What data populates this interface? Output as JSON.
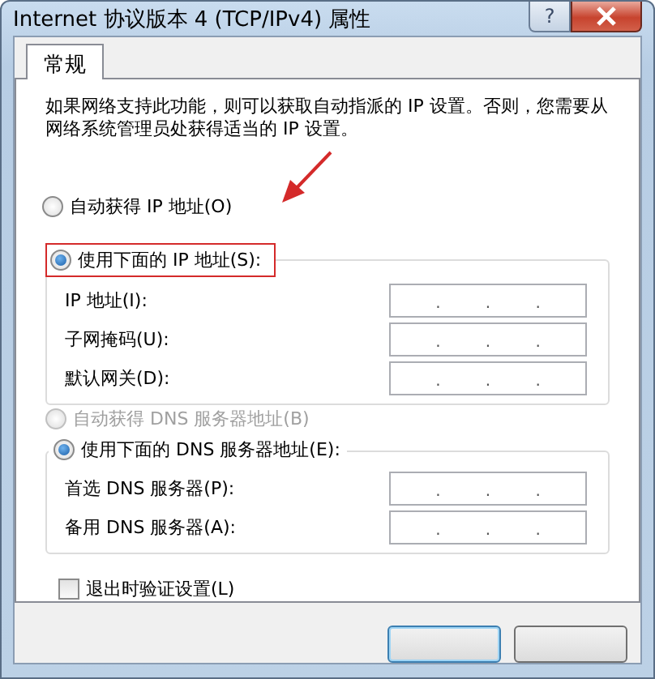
{
  "window": {
    "title": "Internet 协议版本 4 (TCP/IPv4) 属性",
    "help": "?"
  },
  "tabs": [
    {
      "label": "常规",
      "selected": true
    }
  ],
  "description": "如果网络支持此功能，则可以获取自动指派的 IP 设置。否则，您需要从网络系统管理员处获得适当的 IP 设置。",
  "ip_mode": [
    {
      "label": "自动获得 IP 地址(O)",
      "selected": false,
      "disabled": false,
      "highlighted": false
    },
    {
      "label": "使用下面的 IP 地址(S):",
      "selected": true,
      "disabled": false,
      "highlighted": true
    }
  ],
  "ip_fields": [
    {
      "label": "IP 地址(I):",
      "separators": [
        ".",
        ".",
        "."
      ]
    },
    {
      "label": "子网掩码(U):",
      "separators": [
        ".",
        ".",
        "."
      ]
    },
    {
      "label": "默认网关(D):",
      "separators": [
        ".",
        ".",
        "."
      ]
    }
  ],
  "dns_mode": [
    {
      "label": "自动获得 DNS 服务器地址(B)",
      "selected": false,
      "disabled": true
    },
    {
      "label": "使用下面的 DNS 服务器地址(E):",
      "selected": true,
      "disabled": false
    }
  ],
  "dns_fields": [
    {
      "label": "首选 DNS 服务器(P):",
      "separators": [
        ".",
        ".",
        "."
      ]
    },
    {
      "label": "备用 DNS 服务器(A):",
      "separators": [
        ".",
        ".",
        "."
      ]
    }
  ],
  "validate": {
    "label": "退出时验证设置(L)",
    "checked": false
  },
  "buttons": [
    {
      "default": true
    },
    {
      "default": false
    }
  ]
}
